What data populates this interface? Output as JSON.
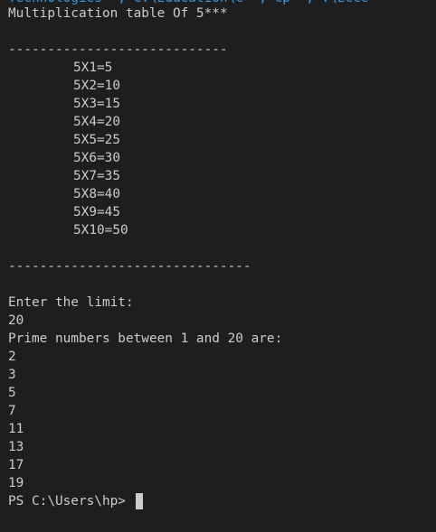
{
  "terminal": {
    "top_partial_line": "Technologies  ; C:\\Education\\C  ; Cp  ; .\\Ecce",
    "heading": "Multiplication table Of 5***",
    "separator_1": "----------------------------",
    "table_rows": [
      "5X1=5",
      "5X2=10",
      "5X3=15",
      "5X4=20",
      "5X5=25",
      "5X6=30",
      "5X7=35",
      "5X8=40",
      "5X9=45",
      "5X10=50"
    ],
    "separator_2": "-------------------------------",
    "limit_prompt": "Enter the limit:",
    "limit_value": "20",
    "primes_heading": "Prime numbers between 1 and 20 are:",
    "primes": [
      "2",
      "3",
      "5",
      "7",
      "11",
      "13",
      "17",
      "19"
    ],
    "shell_prompt": "PS C:\\Users\\hp> "
  },
  "colors": {
    "background": "#1e1e1e",
    "foreground": "#cccccc",
    "partial_line": "#3a96dd"
  },
  "icons": {
    "cursor": "block-cursor-icon"
  }
}
